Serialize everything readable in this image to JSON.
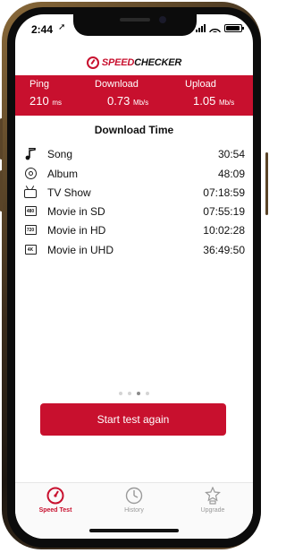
{
  "status_bar": {
    "time": "2:44",
    "location_arrow": "➚"
  },
  "logo": {
    "part1": "SPEED",
    "part2": "CHECKER"
  },
  "stats": {
    "ping": {
      "label": "Ping",
      "value": "210",
      "unit": "ms"
    },
    "download": {
      "label": "Download",
      "value": "0.73",
      "unit": "Mb/s"
    },
    "upload": {
      "label": "Upload",
      "value": "1.05",
      "unit": "Mb/s"
    }
  },
  "section_title": "Download Time",
  "rows": [
    {
      "icon": "music-note-icon",
      "label": "Song",
      "time": "30:54"
    },
    {
      "icon": "album-disc-icon",
      "label": "Album",
      "time": "48:09"
    },
    {
      "icon": "tv-icon",
      "label": "TV Show",
      "time": "07:18:59"
    },
    {
      "icon": "resolution-480-icon",
      "badge": "480",
      "label": "Movie in SD",
      "time": "07:55:19"
    },
    {
      "icon": "resolution-720-icon",
      "badge": "720",
      "label": "Movie in HD",
      "time": "10:02:28"
    },
    {
      "icon": "resolution-4k-icon",
      "badge": "4K",
      "label": "Movie in UHD",
      "time": "36:49:50"
    }
  ],
  "pager": {
    "pages": 4,
    "active_index": 2
  },
  "cta_label": "Start test again",
  "tabs": [
    {
      "label": "Speed Test",
      "icon": "speedometer-icon",
      "active": true
    },
    {
      "label": "History",
      "icon": "clock-icon",
      "active": false
    },
    {
      "label": "Upgrade",
      "icon": "star-trophy-icon",
      "active": false
    }
  ],
  "colors": {
    "brand_red": "#c8102e",
    "inactive_gray": "#9a9a9a"
  }
}
